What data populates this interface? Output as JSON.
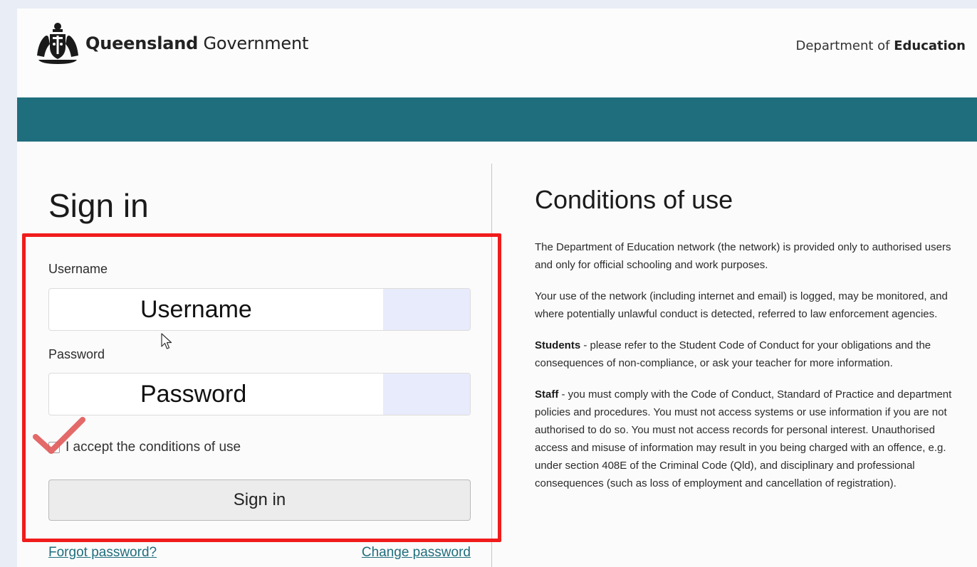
{
  "header": {
    "brand_bold": "Queensland",
    "brand_regular": " Government",
    "dept_prefix": "Department of ",
    "dept_bold": "Education",
    "crest_icon": "queensland-coat-of-arms",
    "band_color": "#1f6e7d"
  },
  "signin": {
    "title": "Sign in",
    "username_label": "Username",
    "username_placeholder": "Username",
    "password_label": "Password",
    "password_placeholder": "Password",
    "accept_label": "I accept the conditions of use",
    "accept_checked": false,
    "submit_label": "Sign in",
    "forgot_link": "Forgot password?",
    "change_link": "Change password"
  },
  "annotations": {
    "highlight_color": "#f01c1c",
    "checkmark_color": "#e25c5c",
    "cursor_icon": "mouse-pointer-icon"
  },
  "conditions": {
    "title": "Conditions of use",
    "p1": "The Department of Education network (the network) is provided only to authorised users and only for official schooling and work purposes.",
    "p2": "Your use of the network (including internet and email) is logged, may be monitored, and where potentially unlawful conduct is detected, referred to law enforcement agencies.",
    "p3_lead": "Students",
    "p3_text": " - please refer to the Student Code of Conduct for your obligations and the consequences of non-compliance, or ask your teacher for more information.",
    "p4_lead": "Staff",
    "p4_text": " - you must comply with the Code of Conduct, Standard of Practice and department policies and procedures. You must not access systems or use information if you are not authorised to do so. You must not access records for personal interest. Unauthorised access and misuse of information may result in you being charged with an offence, e.g. under section 408E of the Criminal Code (Qld), and disciplinary and professional consequences (such as loss of employment and cancellation of registration)."
  }
}
